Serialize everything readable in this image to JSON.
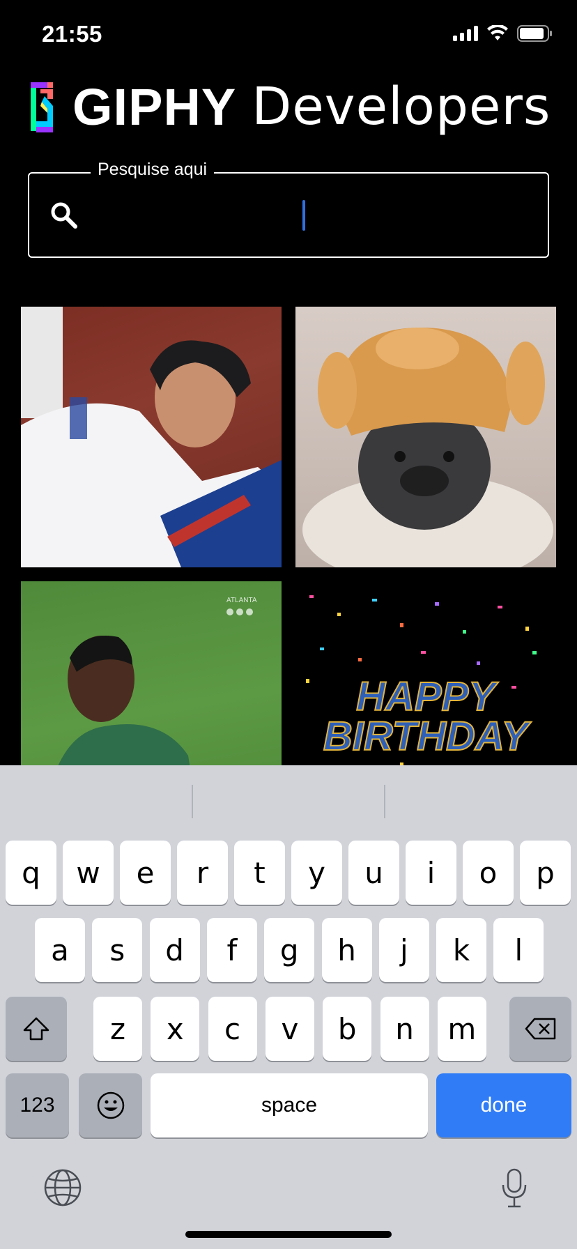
{
  "status_bar": {
    "time": "21:55"
  },
  "logo": {
    "brand": "GIPHY",
    "suffix": "Developers"
  },
  "search": {
    "label": "Pesquise aqui",
    "placeholder": "",
    "value": ""
  },
  "grid": {
    "items": [
      {
        "caption": ""
      },
      {
        "caption": ""
      },
      {
        "caption": "ATLANTA"
      },
      {
        "caption": "HAPPY BIRTHDAY"
      }
    ]
  },
  "keyboard": {
    "row1": [
      "q",
      "w",
      "e",
      "r",
      "t",
      "y",
      "u",
      "i",
      "o",
      "p"
    ],
    "row2": [
      "a",
      "s",
      "d",
      "f",
      "g",
      "h",
      "j",
      "k",
      "l"
    ],
    "row3": [
      "z",
      "x",
      "c",
      "v",
      "b",
      "n",
      "m"
    ],
    "numbers_label": "123",
    "space_label": "space",
    "done_label": "done"
  },
  "colors": {
    "accent": "#2f7cf6",
    "keyboard_bg": "#d1d3d9",
    "caret": "#2f6fe0"
  }
}
